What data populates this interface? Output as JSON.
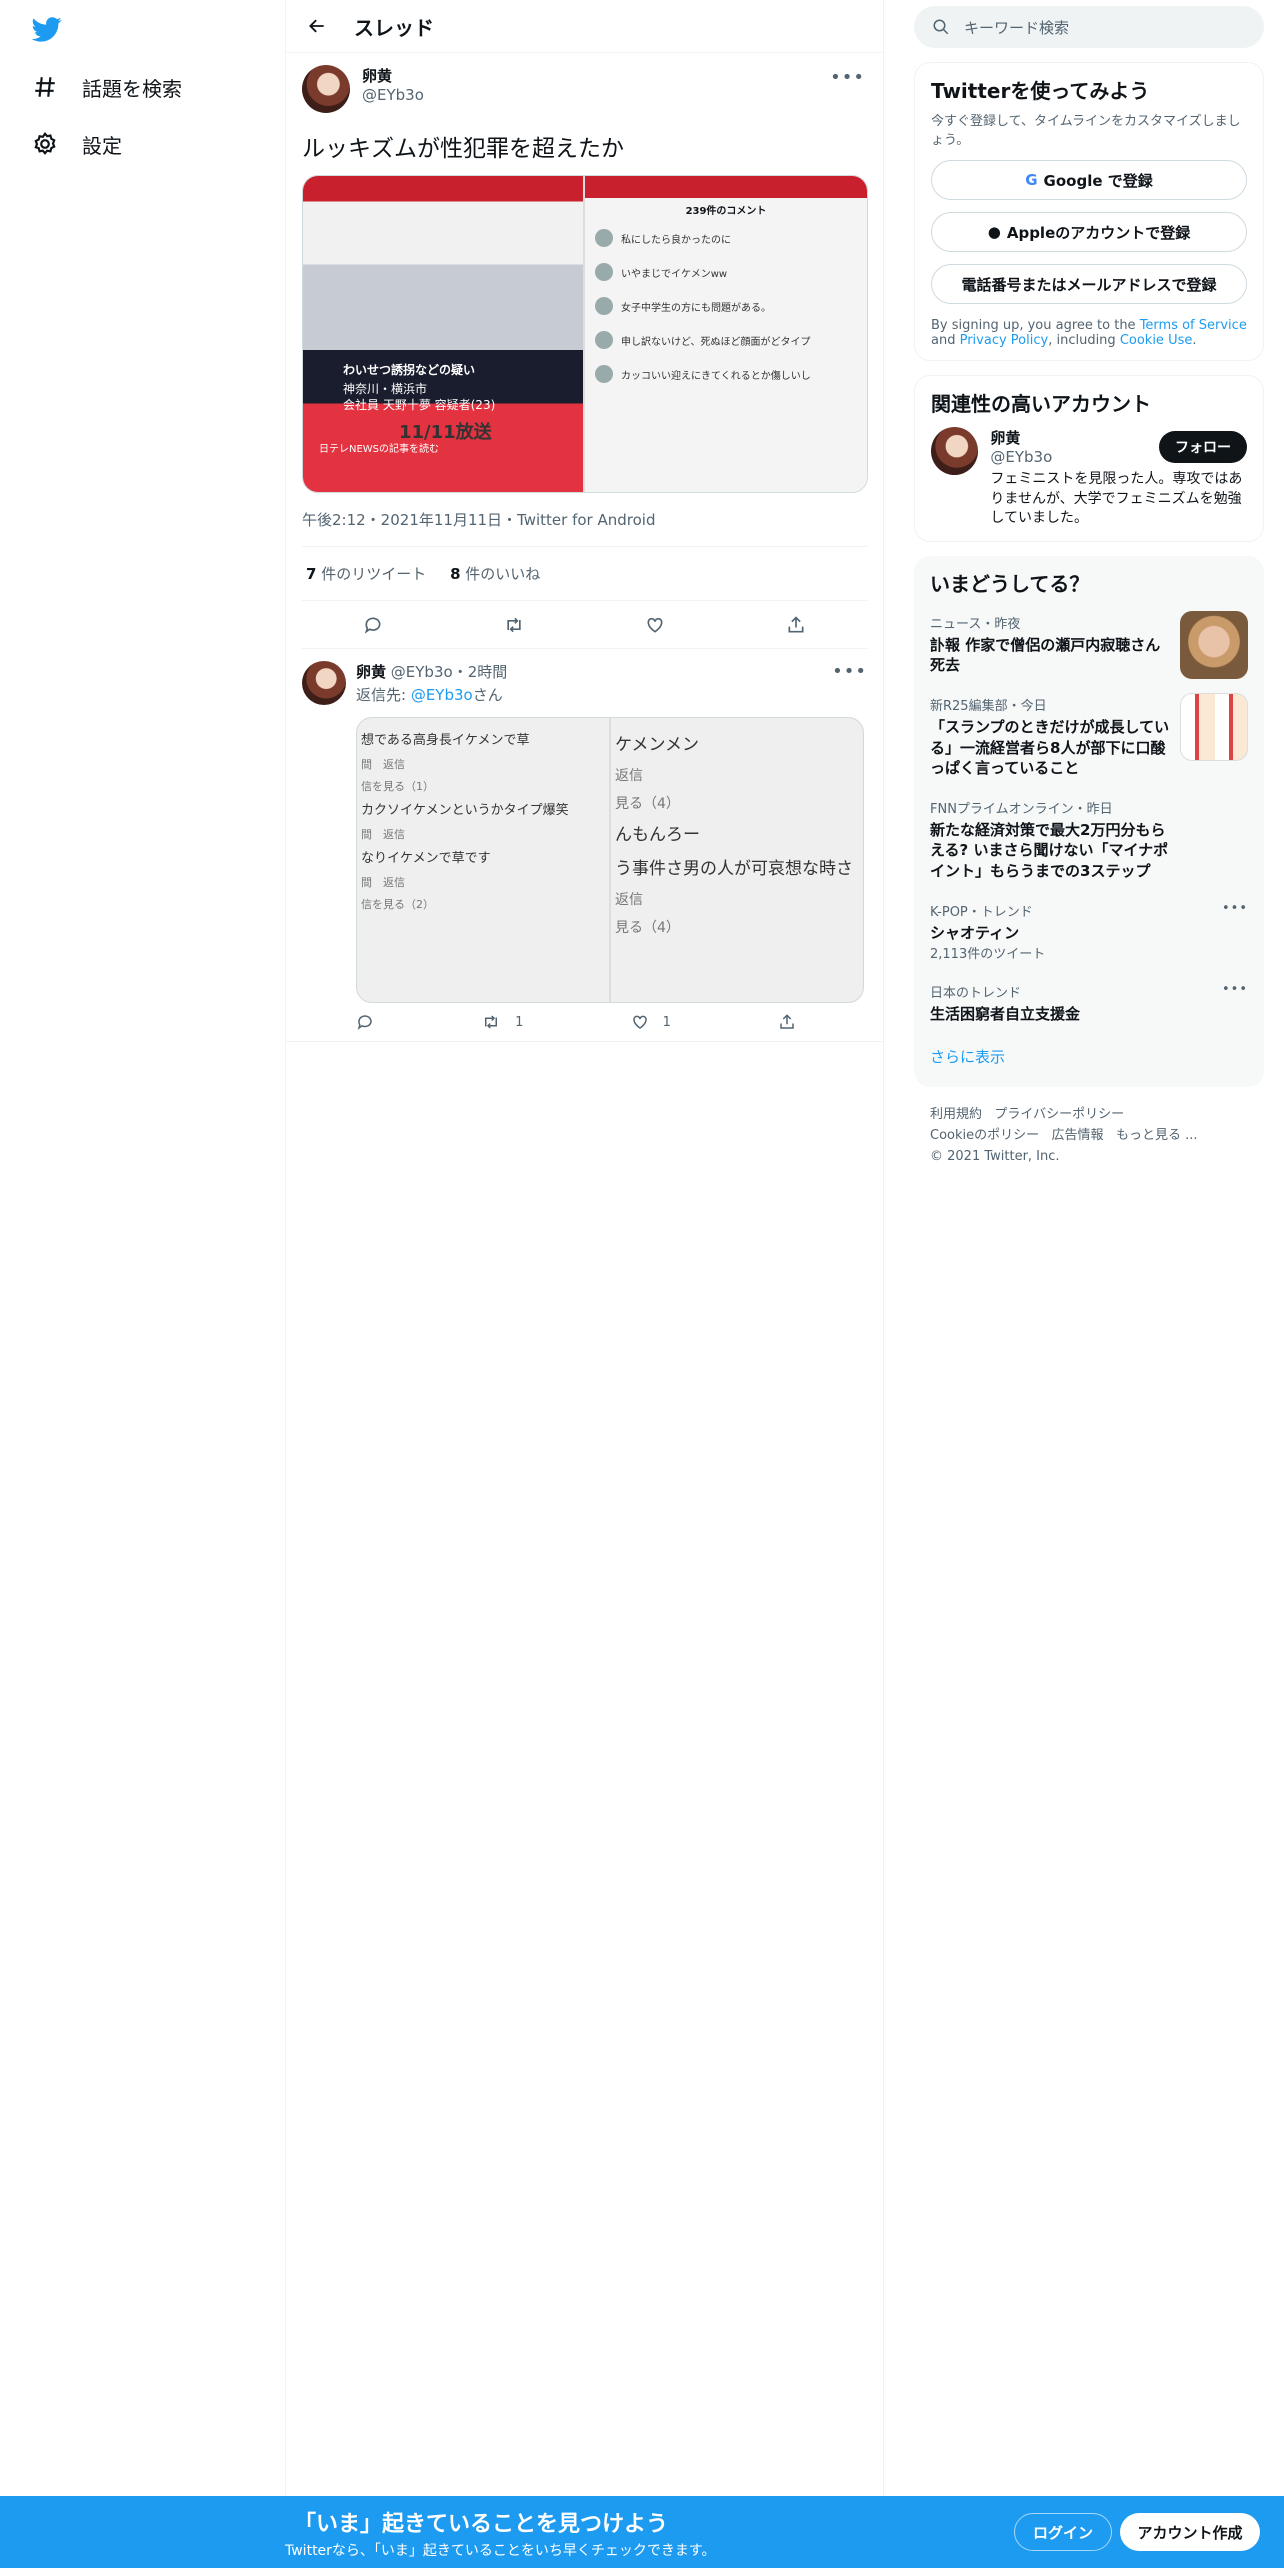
{
  "nav": {
    "explore_label": "話題を検索",
    "settings_label": "設定"
  },
  "header": {
    "title": "スレッド"
  },
  "tweet": {
    "name": "卵黄",
    "handle": "@EYb3o",
    "text": "ルッキズムが性犯罪を超えたか",
    "meta": "午後2:12・2021年11月11日・Twitter for Android",
    "retweet_count": "7",
    "retweet_label": "件のリツイート",
    "like_count": "8",
    "like_label": "件のいいね",
    "media": {
      "left_caption_1": "わいせつ誘拐などの疑い",
      "left_caption_2": "神奈川・横浜市",
      "left_caption_3": "会社員 天野十夢 容疑者(23)",
      "left_date": "11/11放送",
      "left_news": "日テレNEWSの記事を読む",
      "right_header": "239件のコメント",
      "comments": [
        "私にしたら良かったのに",
        "いやまじでイケメンww",
        "女子中学生の方にも問題がある。",
        "申し訳ないけど、死ぬほど顔面がどタイプ",
        "カッコいい迎えにきてくれるとか傷しいし"
      ]
    }
  },
  "reply": {
    "name": "卵黄",
    "handle": "@EYb3o",
    "time": "・2時間",
    "replyto_prefix": "返信先: ",
    "replyto_handle": "@EYb3o",
    "replyto_suffix": "さん",
    "media_left": [
      "想である高身長イケメンで草",
      "間　返信",
      "信を見る（1）",
      "カクソイケメンというかタイプ爆笑",
      "間　返信",
      "なりイケメンで草です",
      "間　返信",
      "信を見る（2）"
    ],
    "media_right": [
      "ケメンメン",
      "返信",
      "見る（4）",
      "んもんろー",
      "う事件さ男の人が可哀想な時さ",
      "返信",
      "見る（4）"
    ],
    "retweets": "1",
    "likes": "1"
  },
  "sidebar": {
    "search_placeholder": "キーワード検索",
    "signup": {
      "title": "Twitterを使ってみよう",
      "subtitle": "今すぐ登録して、タイムラインをカスタマイズしましょう。",
      "google": "Google で登録",
      "apple": "Appleのアカウントで登録",
      "phone": "電話番号またはメールアドレスで登録",
      "terms_1": "By signing up, you agree to the ",
      "terms_link": "Terms of Service",
      "terms_2": " and ",
      "privacy_link": "Privacy Policy",
      "terms_3": ", including ",
      "cookie_link": "Cookie Use",
      "terms_4": "."
    },
    "related": {
      "title": "関連性の高いアカウント",
      "name": "卵黄",
      "handle": "@EYb3o",
      "follow": "フォロー",
      "bio": "フェミニストを見限った人。専攻ではありませんが、大学でフェミニズムを勉強していました。"
    },
    "trends": {
      "title": "いまどうしてる？",
      "items": [
        {
          "context": "ニュース・昨夜",
          "title": "訃報 作家で僧侶の瀬戸内寂聴さん死去"
        },
        {
          "context": "新R25編集部・今日",
          "title": "「スランプのときだけが成長している」一流経営者ら8人が部下に口酸っぱく言っていること"
        },
        {
          "context": "FNNプライムオンライン・昨日",
          "title": "新たな経済対策で最大2万円分もらえる? いまさら聞けない「マイナポイント」もらうまでの3ステップ"
        },
        {
          "context": "K-POP・トレンド",
          "title": "シャオティン",
          "sub": "2,113件のツイート"
        },
        {
          "context": "日本のトレンド",
          "title": "生活困窮者自立支援金"
        }
      ],
      "more": "さらに表示"
    },
    "footer": {
      "terms": "利用規約",
      "privacy": "プライバシーポリシー",
      "cookie": "Cookieのポリシー",
      "ads": "広告情報",
      "more": "もっと見る ...",
      "copyright": "© 2021 Twitter, Inc."
    }
  },
  "bottom_bar": {
    "title": "「いま」起きていることを見つけよう",
    "subtitle": "Twitterなら、「いま」起きていることをいち早くチェックできます。",
    "login": "ログイン",
    "signup": "アカウント作成"
  }
}
